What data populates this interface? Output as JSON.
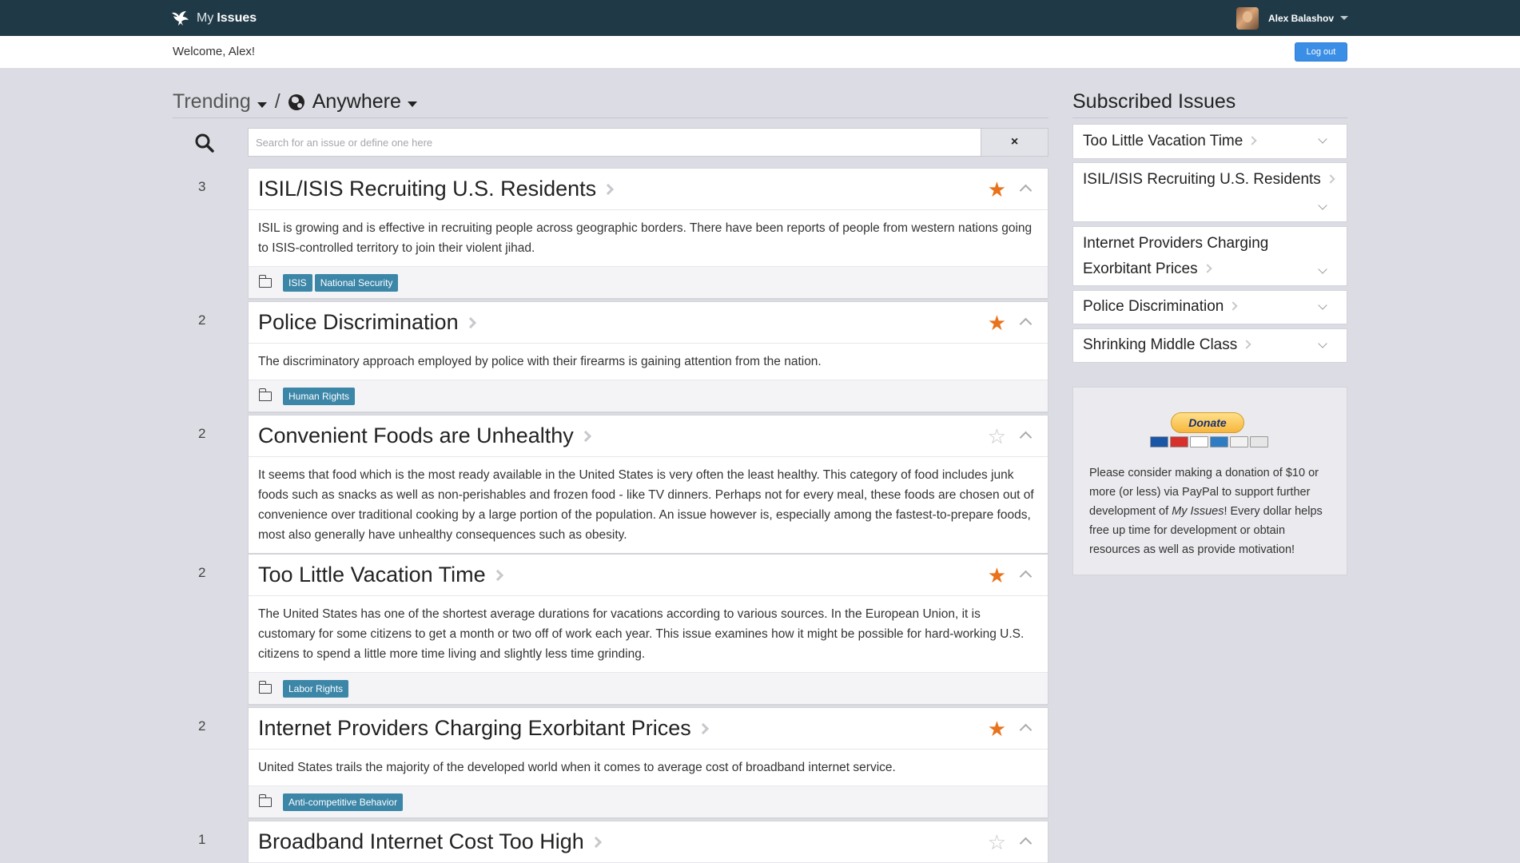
{
  "brand": {
    "prefix": "My",
    "name": "Issues"
  },
  "user": {
    "name": "Alex Balashov"
  },
  "welcome": {
    "text": "Welcome, Alex!",
    "logout_label": "Log out"
  },
  "heading": {
    "sort": "Trending",
    "separator": "/",
    "location": "Anywhere"
  },
  "search": {
    "placeholder": "Search for an issue or define one here",
    "clear_label": "×"
  },
  "issues": [
    {
      "rank": "3",
      "title": "ISIL/ISIS Recruiting U.S. Residents",
      "starred": true,
      "description": "ISIL is growing and is effective in recruiting people across geographic borders. There have been reports of people from western nations going to ISIS-controlled territory to join their violent jihad.",
      "tags": [
        "ISIS",
        "National Security"
      ]
    },
    {
      "rank": "2",
      "title": "Police Discrimination",
      "starred": true,
      "description": "The discriminatory approach employed by police with their firearms is gaining attention from the nation.",
      "tags": [
        "Human Rights"
      ]
    },
    {
      "rank": "2",
      "title": "Convenient Foods are Unhealthy",
      "starred": false,
      "description": "It seems that food which is the most ready available in the United States is very often the least healthy. This category of food includes junk foods such as snacks as well as non-perishables and frozen food - like TV dinners. Perhaps not for every meal, these foods are chosen out of convenience over traditional cooking by a large portion of the population. An issue however is, especially among the fastest-to-prepare foods, most also generally have unhealthy consequences such as obesity.",
      "tags": []
    },
    {
      "rank": "2",
      "title": "Too Little Vacation Time",
      "starred": true,
      "description": "The United States has one of the shortest average durations for vacations according to various sources. In the European Union, it is customary for some citizens to get a month or two off of work each year. This issue examines how it might be possible for hard-working U.S. citizens to spend a little more time living and slightly less time grinding.",
      "tags": [
        "Labor Rights"
      ]
    },
    {
      "rank": "2",
      "title": "Internet Providers Charging Exorbitant Prices",
      "starred": true,
      "description": "United States trails the majority of the developed world when it comes to average cost of broadband internet service.",
      "tags": [
        "Anti-competitive Behavior"
      ]
    },
    {
      "rank": "1",
      "title": "Broadband Internet Cost Too High",
      "starred": false,
      "description": "",
      "tags": []
    }
  ],
  "sidebar": {
    "title": "Subscribed Issues",
    "items": [
      "Too Little Vacation Time",
      "ISIL/ISIS Recruiting U.S. Residents",
      "Internet Providers Charging Exorbitant Prices",
      "Police Discrimination",
      "Shrinking Middle Class"
    ]
  },
  "donate": {
    "button_label": "Donate",
    "text_before": "Please consider making a donation of $10 or more (or less) via PayPal to support further development of ",
    "text_em": "My Issues",
    "text_after": "! Every dollar helps free up time for development or obtain resources as well as provide motivation!",
    "card_names": [
      "maestro-card-icon",
      "mastercard-icon",
      "visa-icon",
      "amex-icon",
      "discover-icon",
      "bank-icon"
    ]
  },
  "colors": {
    "navbar": "#1f3a46",
    "accent": "#3a8ee6",
    "star": "#e8731c",
    "tag": "#3c86a8",
    "background": "#dcdde4"
  }
}
